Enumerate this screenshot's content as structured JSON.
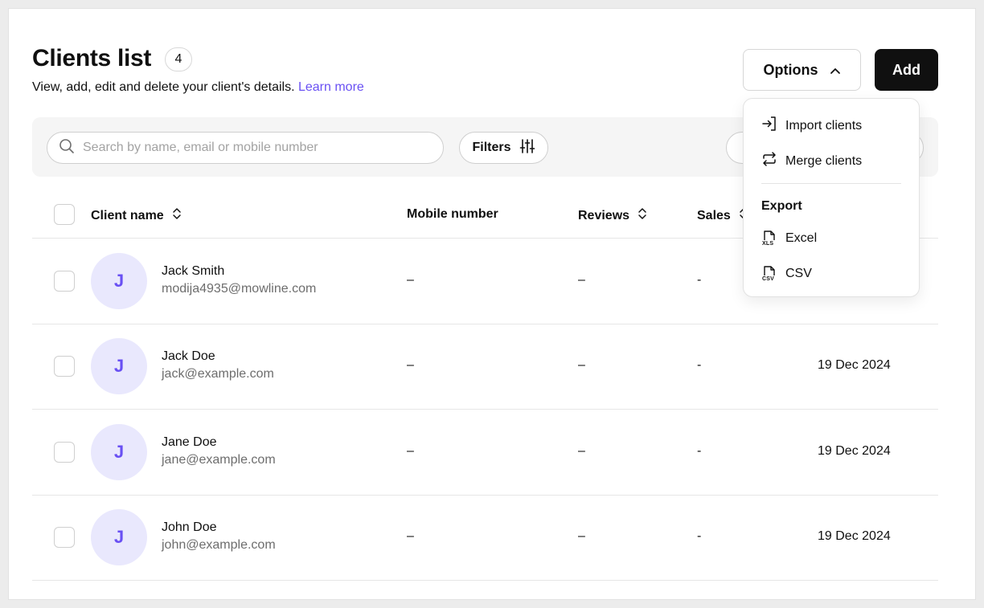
{
  "header": {
    "title": "Clients list",
    "count": "4",
    "subtitle": "View, add, edit and delete your client's details.",
    "learn_more": "Learn more"
  },
  "actions": {
    "options_label": "Options",
    "add_label": "Add"
  },
  "toolbar": {
    "search_placeholder": "Search by name, email or mobile number",
    "filters_label": "Filters"
  },
  "table": {
    "columns": [
      "Client name",
      "Mobile number",
      "Reviews",
      "Sales"
    ],
    "rows": [
      {
        "initial": "J",
        "name": "Jack Smith",
        "email": "modija4935@mowline.com",
        "mobile": "–",
        "reviews": "–",
        "sales": "-",
        "created": ""
      },
      {
        "initial": "J",
        "name": "Jack Doe",
        "email": "jack@example.com",
        "mobile": "–",
        "reviews": "–",
        "sales": "-",
        "created": "19 Dec 2024"
      },
      {
        "initial": "J",
        "name": "Jane Doe",
        "email": "jane@example.com",
        "mobile": "–",
        "reviews": "–",
        "sales": "-",
        "created": "19 Dec 2024"
      },
      {
        "initial": "J",
        "name": "John Doe",
        "email": "john@example.com",
        "mobile": "–",
        "reviews": "–",
        "sales": "-",
        "created": "19 Dec 2024"
      }
    ]
  },
  "options_menu": {
    "items": [
      "Import clients",
      "Merge clients"
    ],
    "export_heading": "Export",
    "export_items": [
      "Excel",
      "CSV"
    ],
    "xls_tag": "XLS",
    "csv_tag": "CSV"
  },
  "colors": {
    "accent": "#6950f3",
    "avatar_bg": "#e9e8fd",
    "primary_button": "#101010"
  },
  "icons": {
    "search": "search-icon",
    "filters": "sliders-icon",
    "options": "chevron-up-icon",
    "sort": "sort-icon",
    "import": "import-icon",
    "merge": "merge-icon",
    "excel": "xls-file-icon",
    "csv": "csv-file-icon"
  }
}
